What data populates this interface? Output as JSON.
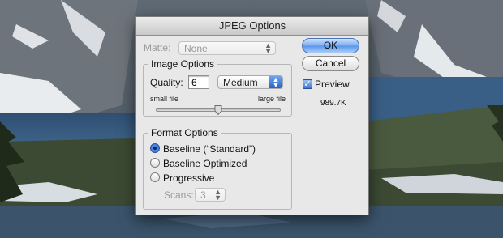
{
  "dialog": {
    "title": "JPEG Options",
    "matte_label": "Matte:",
    "matte_value": "None",
    "image_options": {
      "legend": "Image Options",
      "quality_label": "Quality:",
      "quality_value": "6",
      "quality_preset": "Medium",
      "small_file_label": "small file",
      "large_file_label": "large file",
      "slider_level": 6,
      "slider_max": 12
    },
    "format_options": {
      "legend": "Format Options",
      "options": [
        "Baseline (“Standard”)",
        "Baseline Optimized",
        "Progressive"
      ],
      "selected_index": 0,
      "scans_label": "Scans:",
      "scans_value": "3"
    },
    "ok_label": "OK",
    "cancel_label": "Cancel",
    "preview_label": "Preview",
    "preview_checked": true,
    "file_size": "989.7K"
  },
  "colors": {
    "accent": "#3d78d6",
    "dialog_bg": "#e8e8e8"
  }
}
